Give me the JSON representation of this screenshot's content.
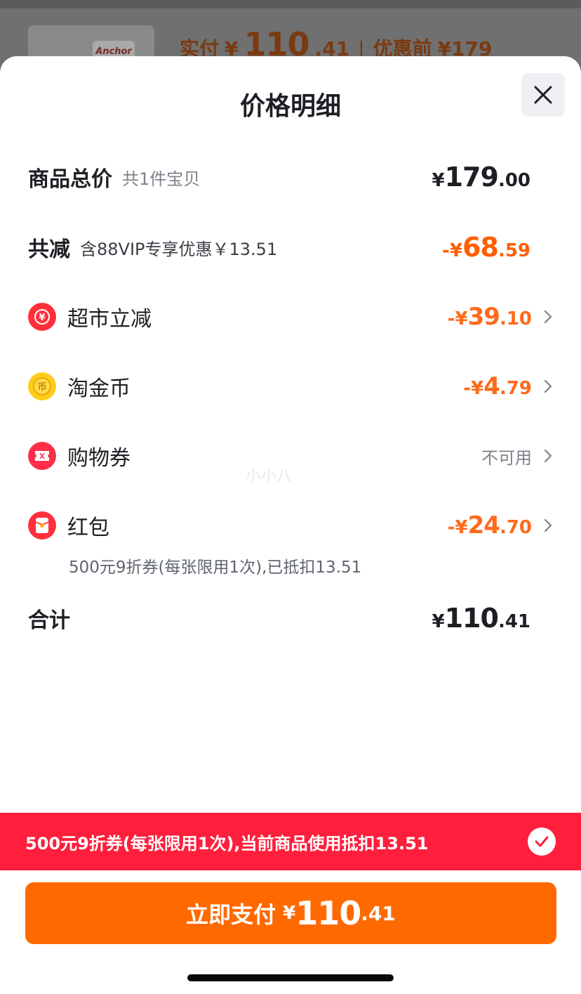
{
  "background": {
    "logo_text": "Anchor",
    "paid_label": "实付",
    "paid_currency": "¥",
    "paid_int": "110",
    "paid_dec": ".41",
    "separator": "|",
    "before_label": "优惠前",
    "before_value": "¥179"
  },
  "sheet": {
    "title": "价格明细",
    "close_icon": "close-icon"
  },
  "total": {
    "label": "商品总价",
    "sub": "共1件宝贝",
    "cur": "¥",
    "int": "179",
    "dec": ".00"
  },
  "discount": {
    "label": "共减",
    "sub": "含88VIP专享优惠￥13.51",
    "cur": "-¥",
    "int": "68",
    "dec": ".59"
  },
  "items": [
    {
      "label": "超市立减",
      "icon": "supermarket-discount-icon",
      "cur": "-¥",
      "int": "39",
      "dec": ".10"
    },
    {
      "label": "淘金币",
      "icon": "gold-coin-icon",
      "cur": "-¥",
      "int": "4",
      "dec": ".79"
    },
    {
      "label": "购物券",
      "icon": "shopping-coupon-icon",
      "status": "不可用"
    },
    {
      "label": "红包",
      "icon": "red-packet-icon",
      "cur": "-¥",
      "int": "24",
      "dec": ".70",
      "note": "500元9折券(每张限用1次),已抵扣13.51"
    }
  ],
  "sum": {
    "label": "合计",
    "cur": "¥",
    "int": "110",
    "dec": ".41"
  },
  "watermark": "小小八",
  "banner": {
    "text": "500元9折券(每张限用1次),当前商品使用抵扣13.51"
  },
  "pay": {
    "label": "立即支付",
    "cur": "¥",
    "int": "110",
    "dec": ".41"
  },
  "colors": {
    "accent_orange": "#ff6a00",
    "banner_red": "#ff1e3c",
    "text_dark": "#1d1f24",
    "text_gray": "#7d818a"
  }
}
